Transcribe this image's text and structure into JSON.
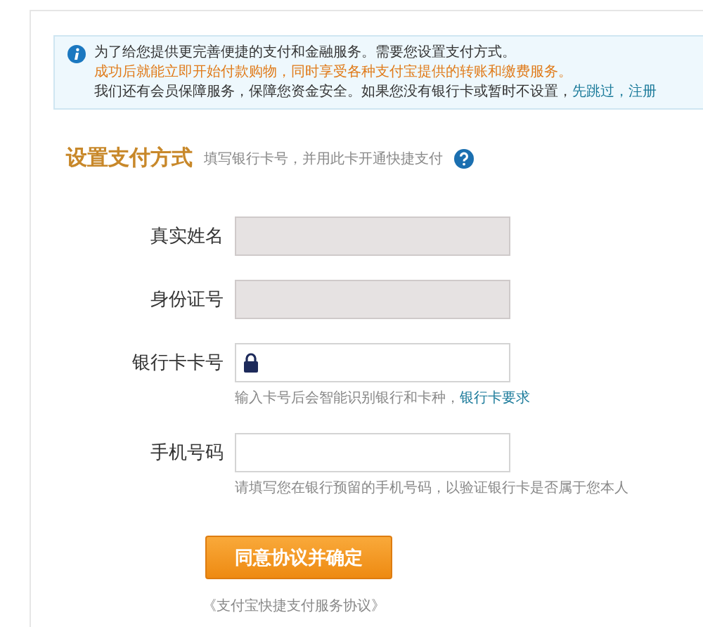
{
  "notice": {
    "lines": [
      [
        {
          "kind": "text",
          "text": "为了给您提供更完善便捷的支付和金融服务。需要您设置支付方式。"
        }
      ],
      [
        {
          "kind": "highlight",
          "text": "成功后就能立即开始付款购物，同时享受各种支付宝提供的转账和缴费服务。"
        }
      ],
      [
        {
          "kind": "text",
          "text": "我们还有会员保障服务，保障您资金安全。如果您没有银行卡或暂时不设置，"
        },
        {
          "kind": "link",
          "text": "先跳过"
        },
        {
          "kind": "link",
          "text": "，注册"
        }
      ]
    ]
  },
  "section": {
    "title": "设置支付方式",
    "subtitle": "填写银行卡号，并用此卡开通快捷支付"
  },
  "fields": [
    {
      "label": "真实姓名",
      "kind": "text",
      "disabled": true
    },
    {
      "label": "身份证号",
      "kind": "text",
      "disabled": true
    },
    {
      "label": "银行卡卡号",
      "kind": "card",
      "disabled": false,
      "hint": [
        {
          "kind": "text",
          "text": "输入卡号后会智能识别银行和卡种，"
        },
        {
          "kind": "link",
          "text": "银行卡要求"
        }
      ]
    },
    {
      "label": "手机号码",
      "kind": "text",
      "disabled": false,
      "hint": [
        {
          "kind": "text",
          "text": "请填写您在银行预留的手机号码，以验证银行卡是否属于您本人"
        }
      ]
    }
  ],
  "submit": "同意协议并确定",
  "agreement": "《支付宝快捷支付服务协议》"
}
